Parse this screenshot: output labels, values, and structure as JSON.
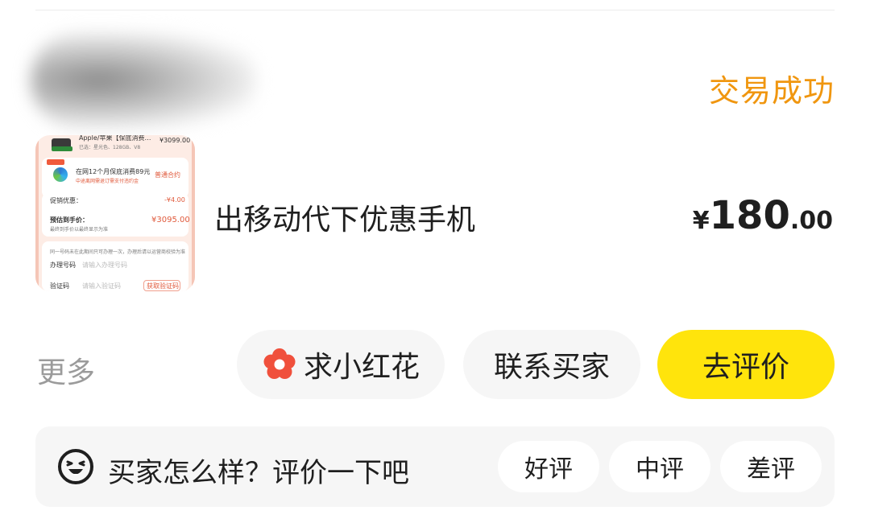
{
  "order": {
    "status": "交易成功",
    "title": "出移动代下优惠手机",
    "price": {
      "currency": "¥",
      "integer": "180",
      "decimal": ".00"
    },
    "thumbnail": {
      "line1": "Apple/苹果【保底消费…",
      "price1": "¥3099.00",
      "spec": "已选：星光色、128GB、V8",
      "promo_line": "在网12个月保底消费89元",
      "promo_sub": "中途离网需退订需支付违约金",
      "contract": "普通合约",
      "discount_label": "促销优惠：",
      "discount_value": "-¥4.00",
      "est_label": "预估到手价：",
      "est_value": "¥3095.00",
      "est_note": "最终到手价以最终显示为准",
      "notice": "同一号码未在此期间只可办理一次，办理后请以运营商校验为准",
      "phone_label": "办理号码",
      "phone_placeholder": "请输入办理号码",
      "code_label": "验证码",
      "code_placeholder": "请输入验证码",
      "code_button": "获取验证码"
    }
  },
  "actions": {
    "more": "更多",
    "flower": "求小红花",
    "contact": "联系买家",
    "review": "去评价"
  },
  "rating": {
    "prompt": "买家怎么样？评价一下吧",
    "good": "好评",
    "mid": "中评",
    "bad": "差评"
  },
  "colors": {
    "status": "#f0960f",
    "review_button": "#ffe40c",
    "flower_icon": "#f0503c"
  },
  "icons": {
    "flower": "flower-icon",
    "face": "laughing-face-icon"
  }
}
